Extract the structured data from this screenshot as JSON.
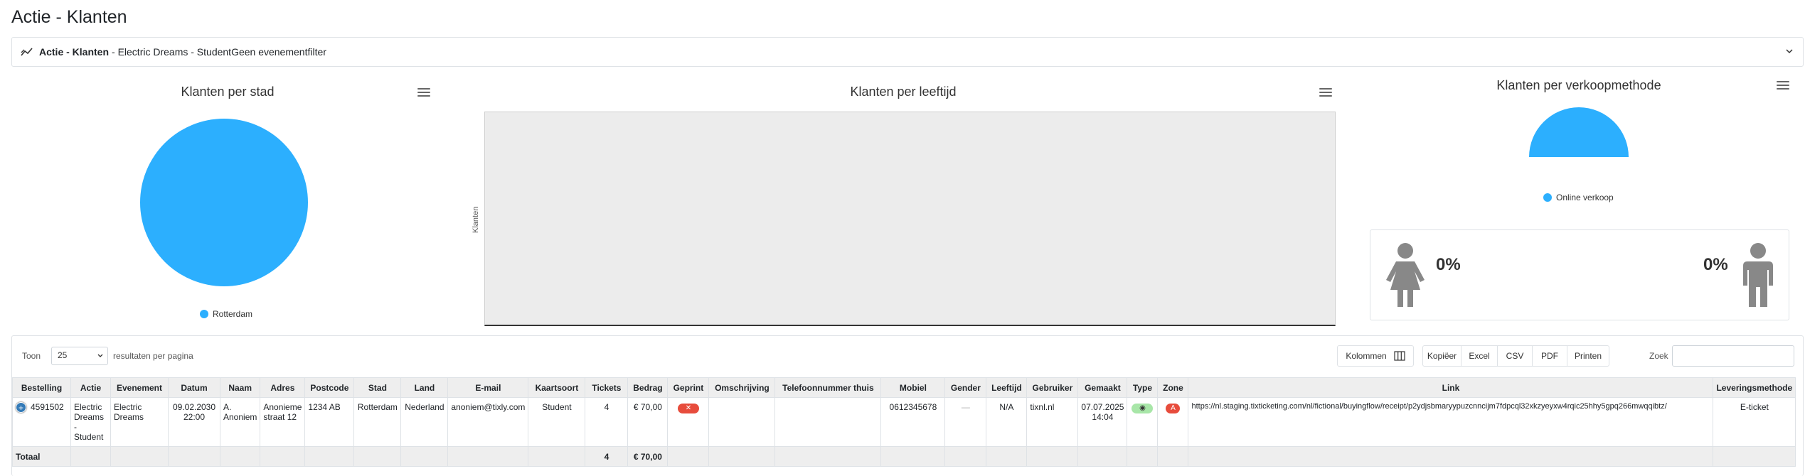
{
  "page": {
    "title": "Actie - Klanten"
  },
  "filter": {
    "bold": "Actie - Klanten",
    "rest": "- Electric Dreams - StudentGeen evenementfilter"
  },
  "charts": {
    "city": {
      "title": "Klanten per stad",
      "legend": "Rotterdam",
      "color": "#2caffe"
    },
    "age": {
      "title": "Klanten per leeftijd",
      "ylabel": "Klanten"
    },
    "method": {
      "title": "Klanten per verkoopmethode",
      "legend": "Online verkoop",
      "color": "#2caffe"
    }
  },
  "chart_data": [
    {
      "type": "pie",
      "title": "Klanten per stad",
      "labels": [
        "Rotterdam"
      ],
      "values": [
        100
      ],
      "colors": [
        "#2caffe"
      ]
    },
    {
      "type": "bar",
      "title": "Klanten per leeftijd",
      "categories": [],
      "values": [],
      "ylabel": "Klanten"
    },
    {
      "type": "pie",
      "title": "Klanten per verkoopmethode",
      "labels": [
        "Online verkoop"
      ],
      "values": [
        100
      ],
      "colors": [
        "#2caffe"
      ],
      "semicircle": true
    }
  ],
  "gender": {
    "female_pct": "0%",
    "male_pct": "0%",
    "icon_color": "#888888"
  },
  "table_controls": {
    "show_prefix": "Toon",
    "page_length": "25",
    "show_suffix": "resultaten per pagina",
    "columns_button": "Kolommen",
    "copy_button": "Kopiëer",
    "excel_button": "Excel",
    "csv_button": "CSV",
    "pdf_button": "PDF",
    "print_button": "Printen",
    "search_label": "Zoek"
  },
  "table": {
    "headers": [
      "Bestelling",
      "Actie",
      "Evenement",
      "Datum",
      "Naam",
      "Adres",
      "Postcode",
      "Stad",
      "Land",
      "E-mail",
      "Kaartsoort",
      "Tickets",
      "Bedrag",
      "Geprint",
      "Omschrijving",
      "Telefoonnummer thuis",
      "Mobiel",
      "Gender",
      "Leeftijd",
      "Gebruiker",
      "Gemaakt",
      "Type",
      "Zone",
      "Link",
      "Leveringsmethode"
    ],
    "row": {
      "bestelling": "4591502",
      "actie": "Electric Dreams - Student",
      "evenement": "Electric Dreams",
      "datum": "09.02.2030 22:00",
      "naam": "A. Anoniem",
      "adres": "Anonieme straat 12",
      "postcode": "1234 AB",
      "stad": "Rotterdam",
      "land": "Nederland",
      "email": "anoniem@tixly.com",
      "kaartsoort": "Student",
      "tickets": "4",
      "bedrag": "€ 70,00",
      "geprint": "✕",
      "omschrijving": "",
      "telefoon": "",
      "mobiel": "0612345678",
      "gender": "—",
      "leeftijd": "N/A",
      "gebruiker": "tixnl.nl",
      "gemaakt": "07.07.2025 14:04",
      "type": "◉",
      "zone": "A",
      "link": "https://nl.staging.tixticketing.com/nl/fictional/buyingflow/receipt/p2ydjsbmaryypuzcnncijm7fdpcql32xkzyeyxw4rqic25hhy5gpq266mwqqibtz/",
      "levering": "E-ticket"
    },
    "total": {
      "label": "Totaal",
      "tickets": "4",
      "bedrag": "€ 70,00"
    }
  },
  "colors": {
    "accent": "#2caffe",
    "danger": "#e74c3c",
    "success_bg": "#a8e6a8",
    "expand": "#337ab7"
  }
}
